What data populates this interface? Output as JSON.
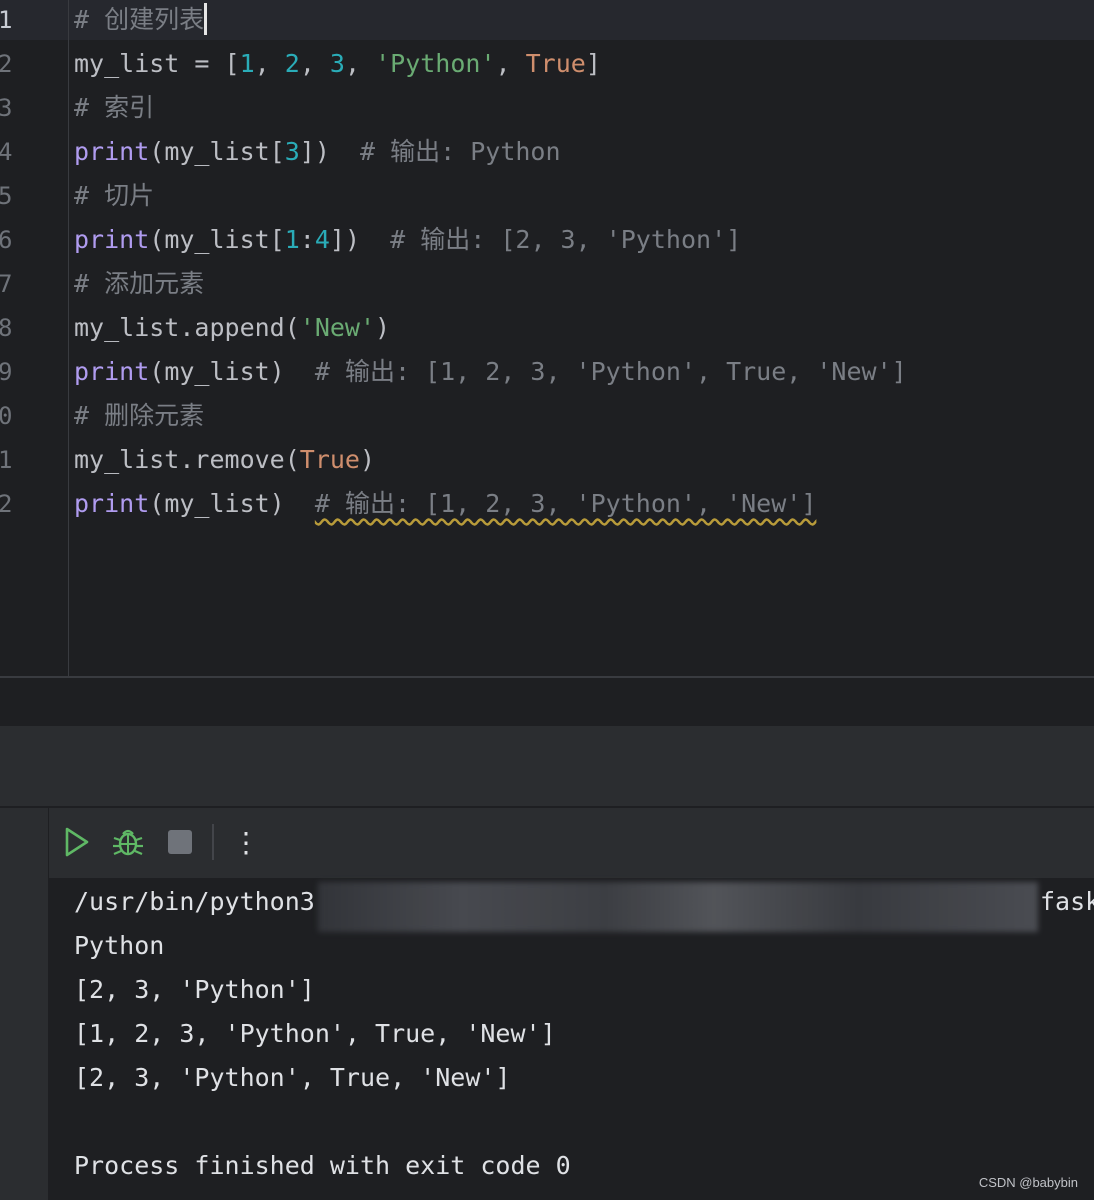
{
  "editor": {
    "line_numbers": [
      "1",
      "2",
      "3",
      "4",
      "5",
      "6",
      "7",
      "8",
      "9",
      "0",
      "1",
      "2"
    ],
    "lines": [
      {
        "comment": "# 创建列表"
      },
      {
        "p1": "my_list = [",
        "n1": "1",
        "s1": ", ",
        "n2": "2",
        "s2": ", ",
        "n3": "3",
        "s3": ", ",
        "str": "'Python'",
        "s4": ", ",
        "kw": "True",
        "s5": "]"
      },
      {
        "comment": "# 索引"
      },
      {
        "fn": "print",
        "p1": "(my_list[",
        "n1": "3",
        "p2": "])  ",
        "comment": "# 输出: Python"
      },
      {
        "comment": "# 切片"
      },
      {
        "fn": "print",
        "p1": "(my_list[",
        "n1": "1",
        "p2": ":",
        "n2": "4",
        "p3": "])  ",
        "comment": "# 输出: [2, 3, 'Python']"
      },
      {
        "comment": "# 添加元素"
      },
      {
        "p1": "my_list.append(",
        "str": "'New'",
        "p2": ")"
      },
      {
        "fn": "print",
        "p1": "(my_list)  ",
        "comment": "# 输出: [1, 2, 3, 'Python', True, 'New']"
      },
      {
        "comment": "# 删除元素"
      },
      {
        "p1": "my_list.remove(",
        "kw": "True",
        "p2": ")"
      },
      {
        "fn": "print",
        "p1": "(my_list)  ",
        "comment": "# 输出: [1, 2, 3, 'Python', 'New']"
      }
    ]
  },
  "toolbar": {
    "run_icon": "play-icon",
    "debug_icon": "bug-icon",
    "stop_icon": "stop-icon",
    "more_icon": "more-vertical-icon",
    "more_glyph": "⋮"
  },
  "console": {
    "command_prefix": "/usr/bin/python3",
    "command_suffix": "fask",
    "output_lines": [
      "Python",
      "[2, 3, 'Python']",
      "[1, 2, 3, 'Python', True, 'New']",
      "[2, 3, 'Python', True, 'New']",
      "",
      "Process finished with exit code 0"
    ]
  },
  "watermark": "CSDN @babybin"
}
